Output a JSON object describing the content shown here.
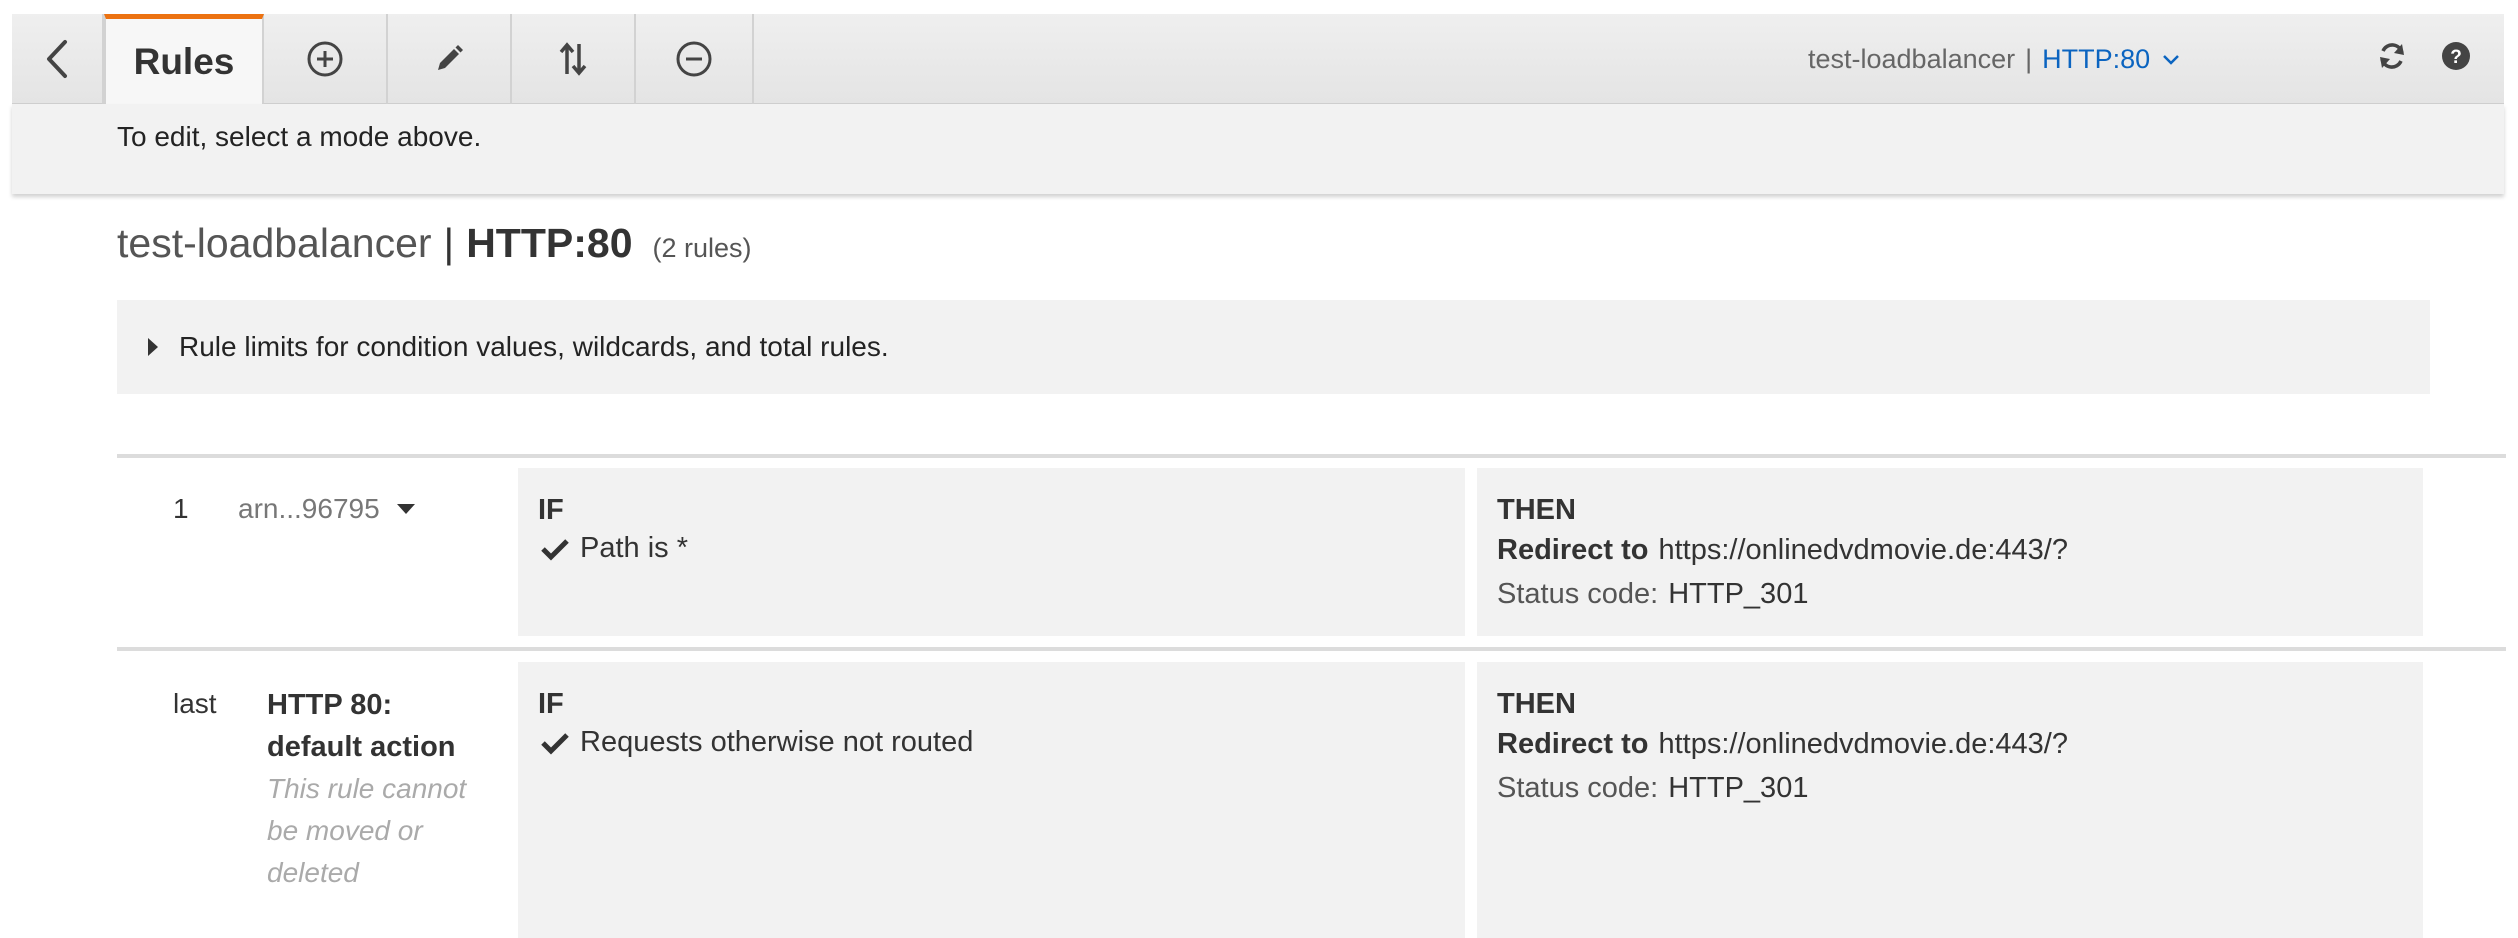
{
  "toolbar": {
    "rules_tab": "Rules",
    "load_balancer": "test-loadbalancer",
    "separator": "|",
    "listener": "HTTP:80",
    "icons": [
      "back-icon",
      "add-icon",
      "edit-icon",
      "reorder-icon",
      "remove-icon",
      "chevron-down-icon",
      "refresh-icon",
      "help-icon"
    ]
  },
  "info": {
    "message": "To edit, select a mode above."
  },
  "heading": {
    "load_balancer": "test-loadbalancer",
    "separator": "|",
    "listener": "HTTP:80",
    "rule_count": "(2 rules)"
  },
  "limits": {
    "text": "Rule limits for condition values, wildcards, and total rules."
  },
  "rules": [
    {
      "priority": "1",
      "arn": "arn...96795",
      "if_label": "IF",
      "condition": "Path is *",
      "then_label": "THEN",
      "action_label": "Redirect to",
      "action_value": "https://onlinedvdmovie.de:443/?",
      "status_label": "Status code:",
      "status_value": "HTTP_301"
    },
    {
      "priority": "last",
      "title_line1": "HTTP 80:",
      "title_line2": "default action",
      "note_line1": "This rule cannot",
      "note_line2": "be moved or",
      "note_line3": "deleted",
      "if_label": "IF",
      "condition": "Requests otherwise not routed",
      "then_label": "THEN",
      "action_label": "Redirect to",
      "action_value": "https://onlinedvdmovie.de:443/?",
      "status_label": "Status code:",
      "status_value": "HTTP_301"
    }
  ],
  "colors": {
    "accent": "#ec7211",
    "link": "#0b64c0",
    "panel": "#f2f2f2"
  }
}
